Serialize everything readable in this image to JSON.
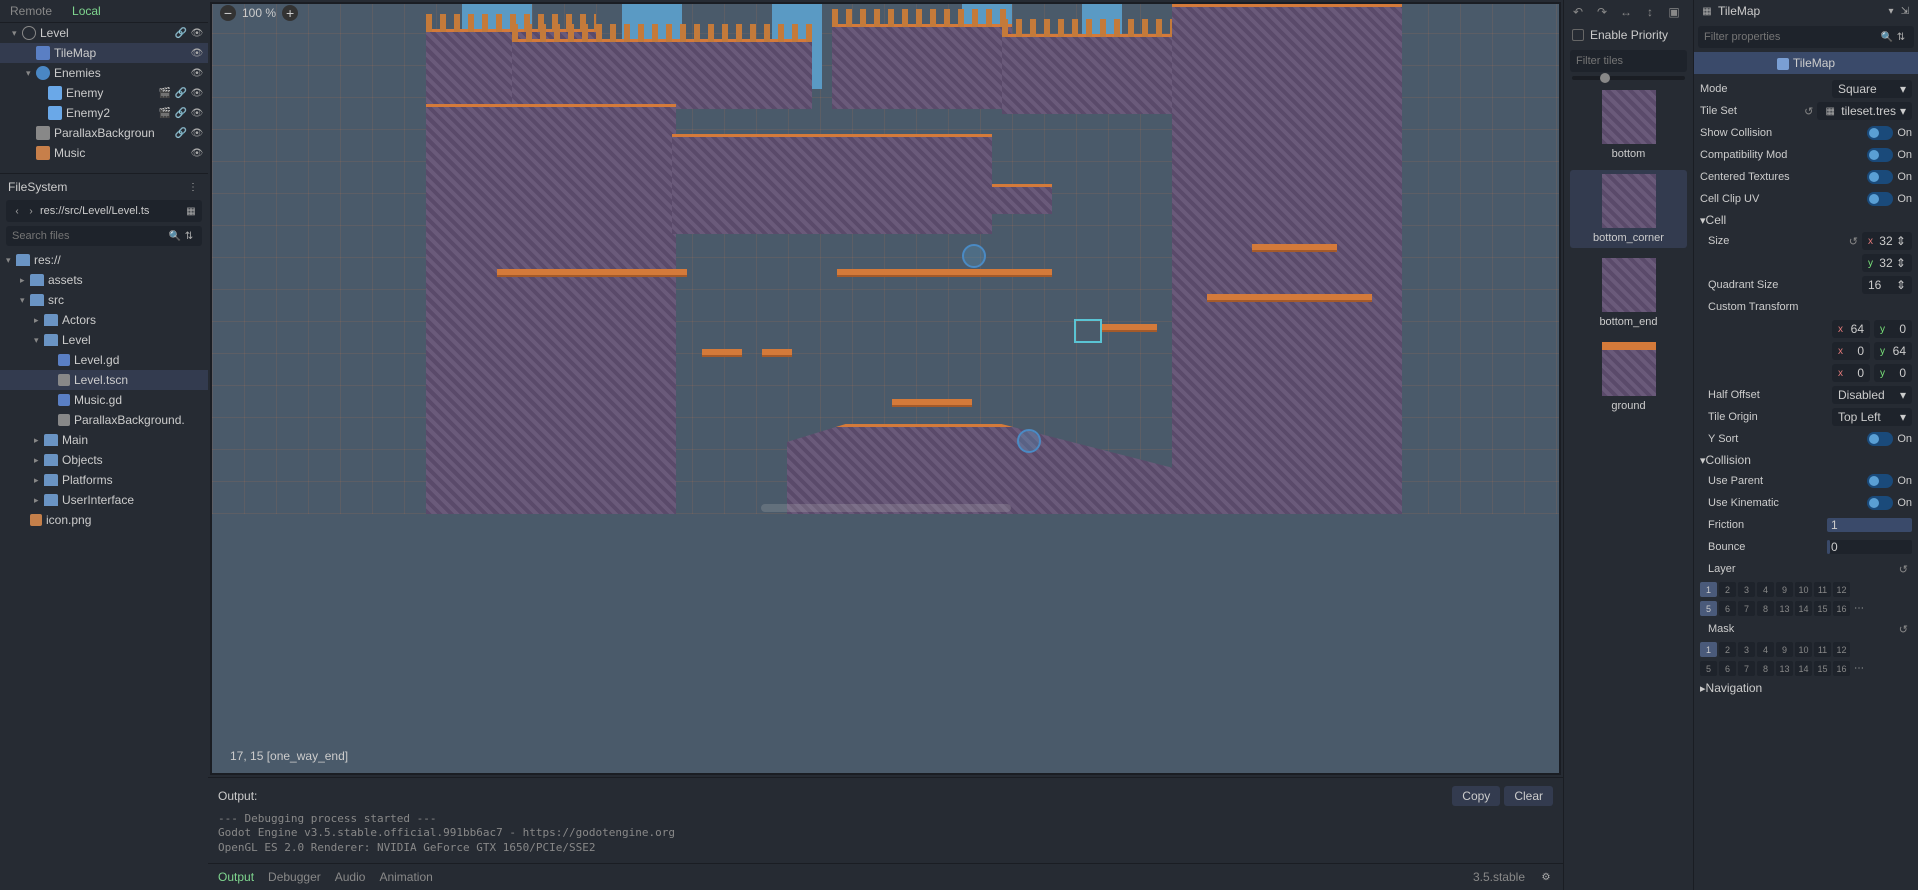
{
  "scene_tabs": {
    "remote": "Remote",
    "local": "Local"
  },
  "scene_tree": [
    {
      "name": "Level",
      "indent": 0,
      "icon": "ic-circle",
      "chev": "▾",
      "icons": [
        "link",
        "eye"
      ]
    },
    {
      "name": "TileMap",
      "indent": 1,
      "icon": "ic-tilemap",
      "selected": true,
      "icons": [
        "eye"
      ]
    },
    {
      "name": "Enemies",
      "indent": 1,
      "icon": "ic-node2d",
      "chev": "▾",
      "icons": [
        "eye"
      ]
    },
    {
      "name": "Enemy",
      "indent": 2,
      "icon": "ic-enemy",
      "icons": [
        "film",
        "link",
        "eye"
      ]
    },
    {
      "name": "Enemy2",
      "indent": 2,
      "icon": "ic-enemy",
      "icons": [
        "film",
        "link",
        "eye"
      ]
    },
    {
      "name": "ParallaxBackgroun",
      "indent": 1,
      "icon": "ic-parallax",
      "icons": [
        "link",
        "eye"
      ]
    },
    {
      "name": "Music",
      "indent": 1,
      "icon": "ic-audio",
      "icons": [
        "eye"
      ]
    }
  ],
  "filesystem": {
    "title": "FileSystem",
    "path": "res://src/Level/Level.ts",
    "search_placeholder": "Search files",
    "tree": [
      {
        "name": "res://",
        "type": "folder",
        "indent": 0,
        "chev": "▾"
      },
      {
        "name": "assets",
        "type": "folder",
        "indent": 1,
        "chev": "▸"
      },
      {
        "name": "src",
        "type": "folder",
        "indent": 1,
        "chev": "▾"
      },
      {
        "name": "Actors",
        "type": "folder",
        "indent": 2,
        "chev": "▸"
      },
      {
        "name": "Level",
        "type": "folder",
        "indent": 2,
        "chev": "▾"
      },
      {
        "name": "Level.gd",
        "type": "file-gd",
        "indent": 3
      },
      {
        "name": "Level.tscn",
        "type": "file-scene",
        "indent": 3,
        "selected": true
      },
      {
        "name": "Music.gd",
        "type": "file-gd",
        "indent": 3
      },
      {
        "name": "ParallaxBackground.",
        "type": "file-scene",
        "indent": 3
      },
      {
        "name": "Main",
        "type": "folder",
        "indent": 2,
        "chev": "▸"
      },
      {
        "name": "Objects",
        "type": "folder",
        "indent": 2,
        "chev": "▸"
      },
      {
        "name": "Platforms",
        "type": "folder",
        "indent": 2,
        "chev": "▸"
      },
      {
        "name": "UserInterface",
        "type": "folder",
        "indent": 2,
        "chev": "▸"
      },
      {
        "name": "icon.png",
        "type": "file-img",
        "indent": 1
      }
    ]
  },
  "viewport": {
    "zoom": "100 %",
    "coord": "17, 15 [one_way_end]"
  },
  "output": {
    "label": "Output:",
    "copy": "Copy",
    "clear": "Clear",
    "text": "--- Debugging process started ---\nGodot Engine v3.5.stable.official.991bb6ac7 - https://godotengine.org\nOpenGL ES 2.0 Renderer: NVIDIA GeForce GTX 1650/PCIe/SSE2"
  },
  "bottom_tabs": [
    "Output",
    "Debugger",
    "Audio",
    "Animation"
  ],
  "version": "3.5.stable",
  "tileset_panel": {
    "priority": "Enable Priority",
    "filter_placeholder": "Filter tiles",
    "tiles": [
      {
        "name": "bottom",
        "ground": false
      },
      {
        "name": "bottom_corner",
        "ground": false,
        "selected": true
      },
      {
        "name": "bottom_end",
        "ground": false
      },
      {
        "name": "ground",
        "ground": true
      }
    ]
  },
  "inspector": {
    "title": "TileMap",
    "filter_placeholder": "Filter properties",
    "banner": "TileMap",
    "mode": {
      "label": "Mode",
      "value": "Square"
    },
    "tileset": {
      "label": "Tile Set",
      "value": "tileset.tres"
    },
    "show_collision": {
      "label": "Show Collision",
      "value": "On"
    },
    "compat": {
      "label": "Compatibility Mod",
      "value": "On"
    },
    "centered": {
      "label": "Centered Textures",
      "value": "On"
    },
    "clip_uv": {
      "label": "Cell Clip UV",
      "value": "On"
    },
    "cell_section": "Cell",
    "size": {
      "label": "Size",
      "x": "32",
      "y": "32"
    },
    "quadrant": {
      "label": "Quadrant Size",
      "value": "16"
    },
    "custom_transform": "Custom Transform",
    "ct": {
      "x1": "64",
      "y1": "0",
      "x2": "0",
      "y2": "64",
      "x3": "0",
      "y3": "0"
    },
    "half_offset": {
      "label": "Half Offset",
      "value": "Disabled"
    },
    "tile_origin": {
      "label": "Tile Origin",
      "value": "Top Left"
    },
    "y_sort": {
      "label": "Y Sort",
      "value": "On"
    },
    "collision_section": "Collision",
    "use_parent": {
      "label": "Use Parent",
      "value": "On"
    },
    "use_kinematic": {
      "label": "Use Kinematic",
      "value": "On"
    },
    "friction": {
      "label": "Friction",
      "value": "1"
    },
    "bounce": {
      "label": "Bounce",
      "value": "0"
    },
    "layer": "Layer",
    "mask": "Mask",
    "layers_row1": [
      "1",
      "2",
      "3",
      "4",
      "9",
      "10",
      "11",
      "12"
    ],
    "layers_row2": [
      "5",
      "6",
      "7",
      "8",
      "13",
      "14",
      "15",
      "16"
    ],
    "navigation": "Navigation"
  }
}
